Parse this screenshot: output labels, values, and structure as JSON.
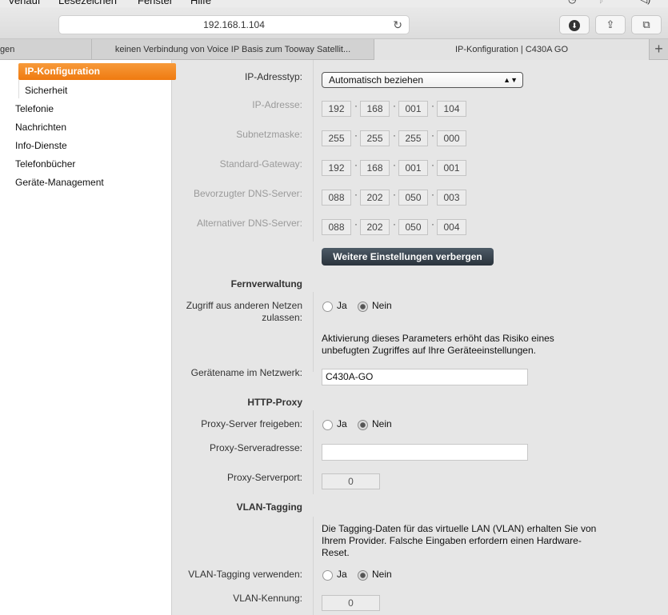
{
  "menubar": {
    "items": [
      "Verlauf",
      "Lesezeichen",
      "Fenster",
      "Hilfe"
    ]
  },
  "toolbar": {
    "address": "192.168.1.104",
    "reload_icon": "↻",
    "download_icon": "⬇",
    "share_icon": "⇪",
    "tabs_icon": "⧉"
  },
  "tabs": [
    {
      "label": "gen"
    },
    {
      "label": "keinen Verbindung von Voice IP Basis zum Tooway Satellit..."
    },
    {
      "label": "IP-Konfiguration | C430A GO"
    }
  ],
  "tab_add": "+",
  "sidebar": {
    "active": "IP-Konfiguration",
    "sub": "Sicherheit",
    "items": [
      "Telefonie",
      "Nachrichten",
      "Info-Dienste",
      "Telefonbücher",
      "Geräte-Management"
    ]
  },
  "form": {
    "ip_type": {
      "label": "IP-Adresstyp:",
      "value": "Automatisch beziehen"
    },
    "ip_address": {
      "label": "IP-Adresse:",
      "parts": [
        "192",
        "168",
        "001",
        "104"
      ]
    },
    "subnet": {
      "label": "Subnetzmaske:",
      "parts": [
        "255",
        "255",
        "255",
        "000"
      ]
    },
    "gateway": {
      "label": "Standard-Gateway:",
      "parts": [
        "192",
        "168",
        "001",
        "001"
      ]
    },
    "dns1": {
      "label": "Bevorzugter DNS-Server:",
      "parts": [
        "088",
        "202",
        "050",
        "003"
      ]
    },
    "dns2": {
      "label": "Alternativer DNS-Server:",
      "parts": [
        "088",
        "202",
        "050",
        "004"
      ]
    },
    "more_button": "Weitere Einstellungen verbergen",
    "fernverwaltung": {
      "title": "Fernverwaltung",
      "access_label_1": "Zugriff aus anderen Netzen",
      "access_label_2": "zulassen:",
      "yes": "Ja",
      "no": "Nein",
      "selected": "Nein",
      "note": "Aktivierung dieses Parameters erhöht das Risiko eines unbefugten Zugriffes auf Ihre Geräteeinstellungen."
    },
    "device_name": {
      "label": "Gerätename im Netzwerk:",
      "value": "C430A-GO"
    },
    "http_proxy": {
      "title": "HTTP-Proxy",
      "enable_label": "Proxy-Server freigeben:",
      "yes": "Ja",
      "no": "Nein",
      "selected": "Nein",
      "address_label": "Proxy-Serveradresse:",
      "address_value": "",
      "port_label": "Proxy-Serverport:",
      "port_value": "0"
    },
    "vlan": {
      "title": "VLAN-Tagging",
      "note": "Die Tagging-Daten für das virtuelle LAN (VLAN) erhalten Sie von Ihrem Provider. Falsche Eingaben erfordern einen Hardware-Reset.",
      "use_label": "VLAN-Tagging verwenden:",
      "yes": "Ja",
      "no": "Nein",
      "selected": "Nein",
      "id_label": "VLAN-Kennung:",
      "id_value": "0"
    }
  }
}
